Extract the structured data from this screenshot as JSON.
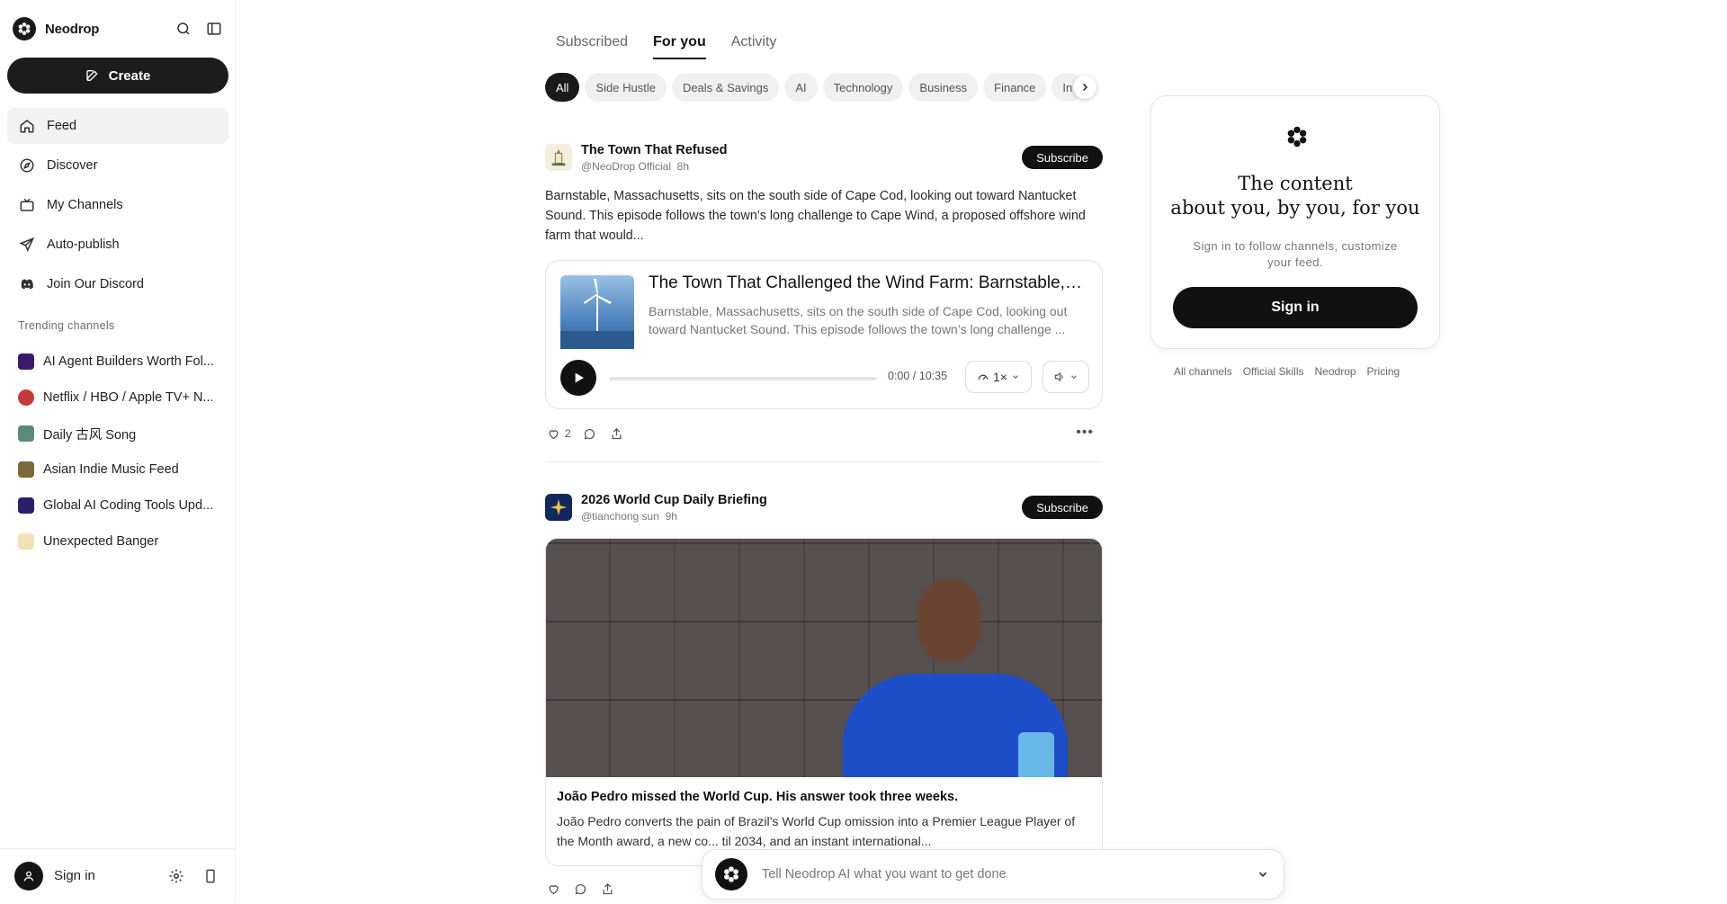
{
  "sidebar": {
    "brand": "Neodrop",
    "create_label": "Create",
    "nav": [
      {
        "label": "Feed",
        "icon": "home-icon",
        "active": true
      },
      {
        "label": "Discover",
        "icon": "compass-icon"
      },
      {
        "label": "My Channels",
        "icon": "tv-icon"
      },
      {
        "label": "Auto-publish",
        "icon": "send-icon"
      },
      {
        "label": "Join Our Discord",
        "icon": "discord-icon"
      }
    ],
    "trending_heading": "Trending channels",
    "trending": [
      {
        "label": "AI Agent Builders Worth Fol...",
        "color": "#3b1a6b"
      },
      {
        "label": "Netflix / HBO / Apple TV+ N...",
        "color": "#c23a3a"
      },
      {
        "label": "Daily 古风 Song",
        "color": "#5b8a7a"
      },
      {
        "label": "Asian Indie Music Feed",
        "color": "#7a6a3a"
      },
      {
        "label": "Global AI Coding Tools Upd...",
        "color": "#2a1f6b"
      },
      {
        "label": "Unexpected Banger",
        "color": "#e6a13b"
      }
    ],
    "signin_label": "Sign in"
  },
  "tabs": [
    {
      "label": "Subscribed"
    },
    {
      "label": "For you",
      "active": true
    },
    {
      "label": "Activity"
    }
  ],
  "chips": [
    "All",
    "Side Hustle",
    "Deals & Savings",
    "AI",
    "Technology",
    "Business",
    "Finance",
    "In"
  ],
  "posts": [
    {
      "channel": "The Town That Refused",
      "handle": "@NeoDrop Official",
      "age": "8h",
      "subscribe_label": "Subscribe",
      "text": "Barnstable, Massachusetts, sits on the south side of Cape Cod, looking out toward Nantucket Sound. This episode follows the town’s long challenge to Cape Wind, a proposed offshore wind farm that would...",
      "audio": {
        "title": "The Town That Challenged the Wind Farm: Barnstable, ...",
        "desc": "Barnstable, Massachusetts, sits on the south side of Cape Cod, looking out toward Nantucket Sound. This episode follows the town’s long challenge ...",
        "time": "0:00 / 10:35",
        "speed": "1×",
        "progress": 0
      },
      "likes": "2"
    },
    {
      "channel": "2026 World Cup Daily Briefing",
      "handle": "@tianchong sun",
      "age": "9h",
      "subscribe_label": "Subscribe",
      "card_title": "João Pedro missed the World Cup. His answer took three weeks.",
      "card_desc": "João Pedro converts the pain of Brazil’s World Cup omission into a Premier League Player of the Month award, a new co... til 2034, and an instant international..."
    }
  ],
  "promo": {
    "title_line1": "The content",
    "title_line2": "about you, by you, for you",
    "subtitle": "Sign in to follow channels, customize your feed.",
    "button": "Sign in"
  },
  "footer_links": [
    "All channels",
    "Official Skills",
    "Neodrop",
    "Pricing"
  ],
  "chat": {
    "placeholder": "Tell Neodrop AI what you want to get done"
  }
}
